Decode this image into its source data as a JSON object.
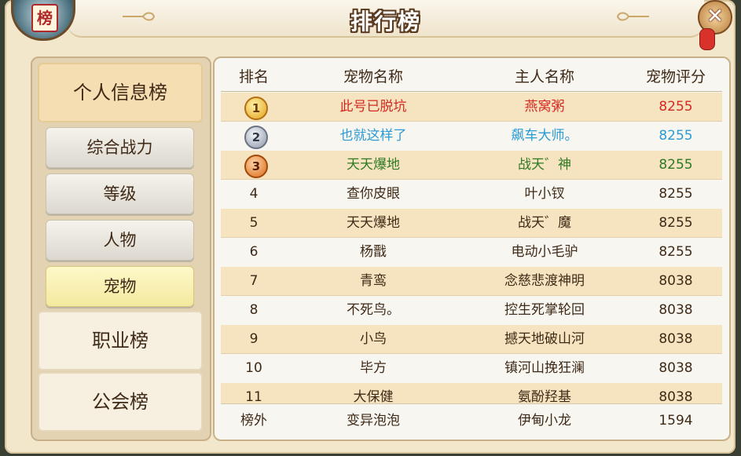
{
  "title": "排行榜",
  "badge": "榜",
  "close_label": "✕",
  "sidebar": {
    "categories": [
      {
        "label": "个人信息榜"
      },
      {
        "label": "职业榜"
      },
      {
        "label": "公会榜"
      }
    ],
    "subs": [
      {
        "label": "综合战力"
      },
      {
        "label": "等级"
      },
      {
        "label": "人物"
      },
      {
        "label": "宠物"
      }
    ]
  },
  "table": {
    "headers": [
      "排名",
      "宠物名称",
      "主人名称",
      "宠物评分"
    ],
    "rows": [
      {
        "rank": "1",
        "pet": "此号已脱坑",
        "owner": "燕窝粥",
        "score": "8255"
      },
      {
        "rank": "2",
        "pet": "也就这样了",
        "owner": "飙车大师。",
        "score": "8255"
      },
      {
        "rank": "3",
        "pet": "天天爆地",
        "owner": "战天゛神",
        "score": "8255"
      },
      {
        "rank": "4",
        "pet": "查你皮眼",
        "owner": "叶小钗",
        "score": "8255"
      },
      {
        "rank": "5",
        "pet": "天天爆地",
        "owner": "战天゛魔",
        "score": "8255"
      },
      {
        "rank": "6",
        "pet": "杨戬",
        "owner": "电动小毛驴",
        "score": "8255"
      },
      {
        "rank": "7",
        "pet": "青鸾",
        "owner": "念慈悲渡神明",
        "score": "8038"
      },
      {
        "rank": "8",
        "pet": "不死鸟。",
        "owner": "控生死掌轮回",
        "score": "8038"
      },
      {
        "rank": "9",
        "pet": "小鸟",
        "owner": "撼天地破山河",
        "score": "8038"
      },
      {
        "rank": "10",
        "pet": "毕方",
        "owner": "镇河山挽狂澜",
        "score": "8038"
      },
      {
        "rank": "11",
        "pet": "大保健",
        "owner": "氨酚羟基",
        "score": "8038"
      }
    ],
    "self_row": {
      "rank": "榜外",
      "pet": "变异泡泡",
      "owner": "伊甸小龙",
      "score": "1594"
    }
  },
  "colors": {
    "rank1": "#d32a22",
    "rank2": "#2a9bd4",
    "rank3": "#2e7a25"
  }
}
